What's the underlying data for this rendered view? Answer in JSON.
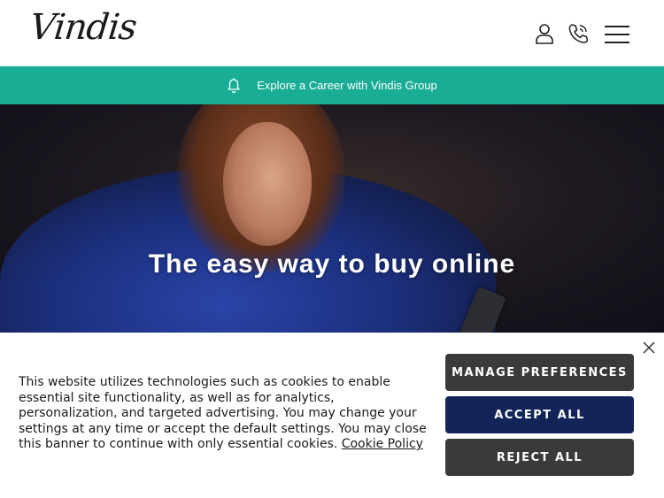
{
  "header": {
    "logo_text": "Vindis",
    "icons": [
      "account-icon",
      "phone-icon",
      "menu-icon"
    ]
  },
  "career_banner": {
    "icon": "bell-icon",
    "text": "Explore a Career with Vindis Group",
    "color": "#1aad95"
  },
  "hero": {
    "title": "The easy way to buy online"
  },
  "cookie_banner": {
    "message": "This website utilizes technologies such as cookies to enable essential site functionality, as well as for analytics, personalization, and targeted advertising. You may change your settings at any time or accept the default settings. You may close this banner to continue with only essential cookies.",
    "policy_link": "Cookie Policy",
    "manage_label": "MANAGE PREFERENCES",
    "accept_label": "ACCEPT ALL",
    "reject_label": "REJECT ALL",
    "close_icon": "close-icon",
    "accept_color": "#132558",
    "secondary_color": "#3a3a3a"
  }
}
